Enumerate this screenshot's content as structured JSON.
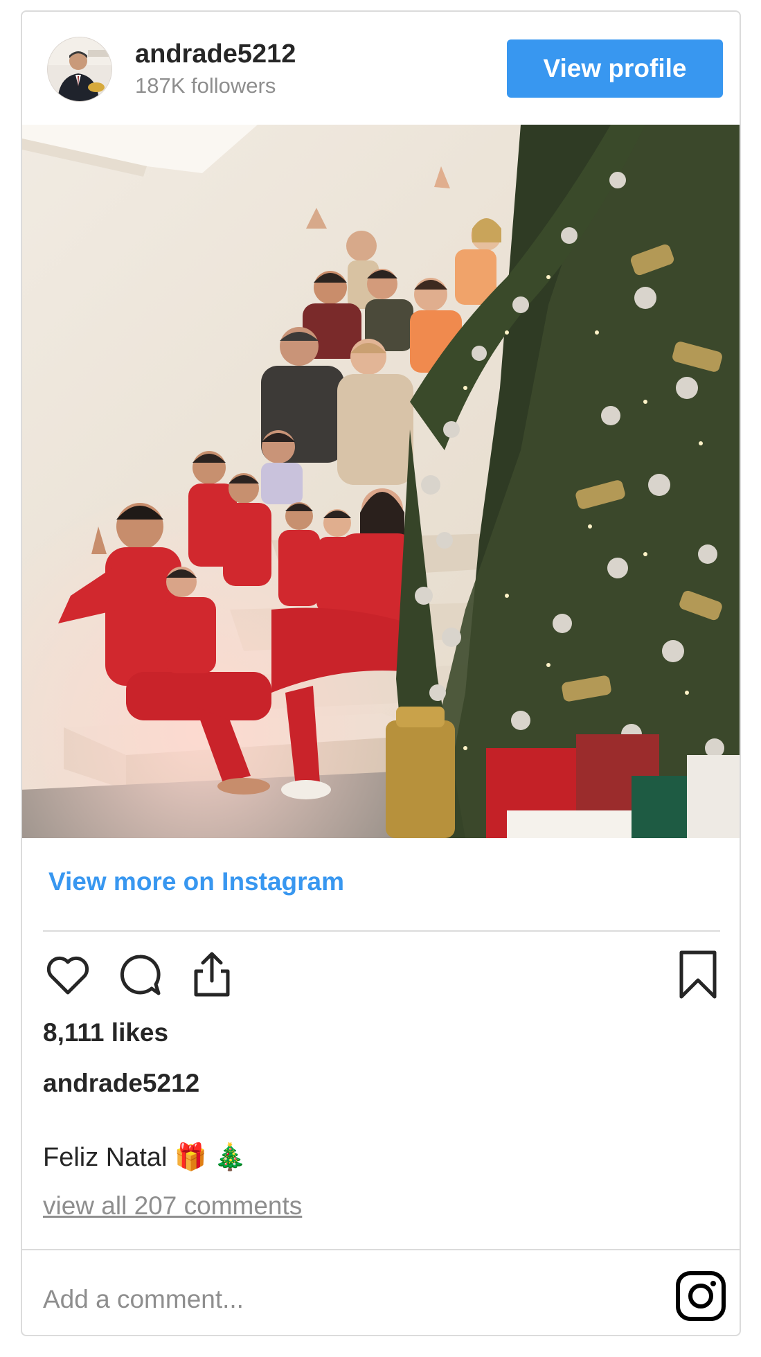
{
  "header": {
    "username": "andrade5212",
    "followers": "187K followers",
    "view_profile_label": "View profile"
  },
  "post": {
    "photo_icon": "family-christmas-photo",
    "view_more_label": "View more on Instagram",
    "likes": "8,111 likes",
    "caption_user": "andrade5212",
    "caption_text": "Feliz Natal",
    "caption_emojis": [
      "🎁",
      "🎄"
    ],
    "comments_link": "view all 207 comments"
  },
  "actions": {
    "like_icon": "heart-icon",
    "comment_icon": "comment-icon",
    "share_icon": "share-icon",
    "save_icon": "bookmark-icon"
  },
  "footer": {
    "comment_placeholder": "Add a comment...",
    "brand_icon": "instagram-icon"
  },
  "colors": {
    "accent": "#3897f0",
    "text": "#262626",
    "muted": "#8e8e8e",
    "border": "#dbdbdb"
  }
}
